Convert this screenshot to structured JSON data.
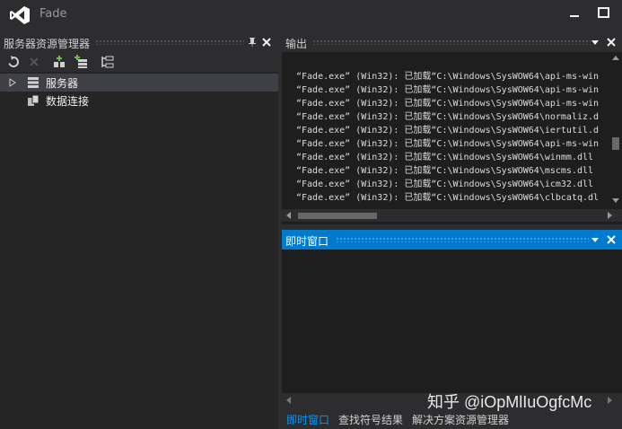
{
  "window": {
    "title": "Fade"
  },
  "server_explorer": {
    "title": "服务器资源管理器",
    "tree": [
      {
        "label": "服务器",
        "icon": "server-icon",
        "expander": "expand-arrow-icon",
        "selected": true
      },
      {
        "label": "数据连接",
        "icon": "database-icon",
        "selected": false
      }
    ]
  },
  "output": {
    "title": "输出",
    "lines": [
      "“Fade.exe” (Win32): 已加载“C:\\Windows\\SysWOW64\\api-ms-win",
      "“Fade.exe” (Win32): 已加载“C:\\Windows\\SysWOW64\\api-ms-win",
      "“Fade.exe” (Win32): 已加载“C:\\Windows\\SysWOW64\\api-ms-win",
      "“Fade.exe” (Win32): 已加载“C:\\Windows\\SysWOW64\\normaliz.d",
      "“Fade.exe” (Win32): 已加载“C:\\Windows\\SysWOW64\\iertutil.d",
      "“Fade.exe” (Win32): 已加载“C:\\Windows\\SysWOW64\\api-ms-win",
      "“Fade.exe” (Win32): 已加载“C:\\Windows\\SysWOW64\\winmm.dll",
      "“Fade.exe” (Win32): 已加载“C:\\Windows\\SysWOW64\\mscms.dll",
      "“Fade.exe” (Win32): 已加载“C:\\Windows\\SysWOW64\\icm32.dll",
      "“Fade.exe” (Win32): 已加载“C:\\Windows\\SysWOW64\\clbcatq.dl"
    ]
  },
  "immediate": {
    "title": "即时窗口"
  },
  "bottom_tabs": [
    "即时窗口",
    "查找符号结果",
    "解决方案资源管理器"
  ],
  "watermark": "知乎 @iOpMlIuOgfcMc",
  "colors": {
    "accent": "#007acc",
    "active_tab_text": "#0097fb",
    "background": "#2d2d30",
    "editor": "#1e1e1e"
  }
}
